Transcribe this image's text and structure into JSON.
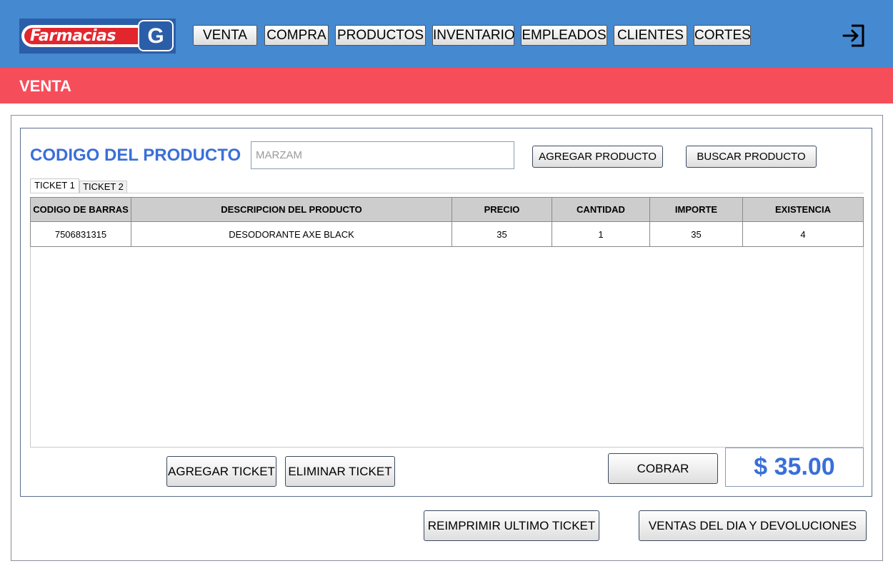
{
  "app": {
    "logo_text": "Farmacias",
    "logo_mark": "G"
  },
  "nav": {
    "items": [
      {
        "label": "VENTA"
      },
      {
        "label": "COMPRA"
      },
      {
        "label": "PRODUCTOS"
      },
      {
        "label": "INVENTARIO"
      },
      {
        "label": "EMPLEADOS"
      },
      {
        "label": "CLIENTES"
      },
      {
        "label": "CORTES"
      }
    ],
    "exit_icon": "logout-icon"
  },
  "section": {
    "title": "VENTA"
  },
  "product": {
    "code_label": "CODIGO DEL PRODUCTO",
    "code_placeholder": "MARZAM",
    "code_value": "",
    "add_label": "AGREGAR PRODUCTO",
    "search_label": "BUSCAR PRODUCTO"
  },
  "tabs": [
    {
      "label": "TICKET 1"
    },
    {
      "label": "TICKET 2"
    }
  ],
  "table": {
    "columns": [
      "CODIGO DE BARRAS",
      "DESCRIPCION DEL PRODUCTO",
      "PRECIO",
      "CANTIDAD",
      "IMPORTE",
      "EXISTENCIA"
    ],
    "rows": [
      [
        "7506831315",
        "DESODORANTE AXE BLACK",
        "35",
        "1",
        "35",
        "4"
      ]
    ]
  },
  "ticket_actions": {
    "add_label": "AGREGAR TICKET",
    "delete_label": "ELIMINAR TICKET"
  },
  "checkout": {
    "cobrar_label": "COBRAR",
    "total": "$ 35.00"
  },
  "footer": {
    "reprint_label": "REIMPRIMIR ULTIMO TICKET",
    "sales_label": "VENTAS DEL DIA Y DEVOLUCIONES"
  },
  "colors": {
    "topbar": "#4589d0",
    "section_bar": "#f64d5b",
    "accent_text": "#3a6fd9",
    "logo_red": "#e3262d",
    "logo_blue": "#2b5ea8"
  }
}
